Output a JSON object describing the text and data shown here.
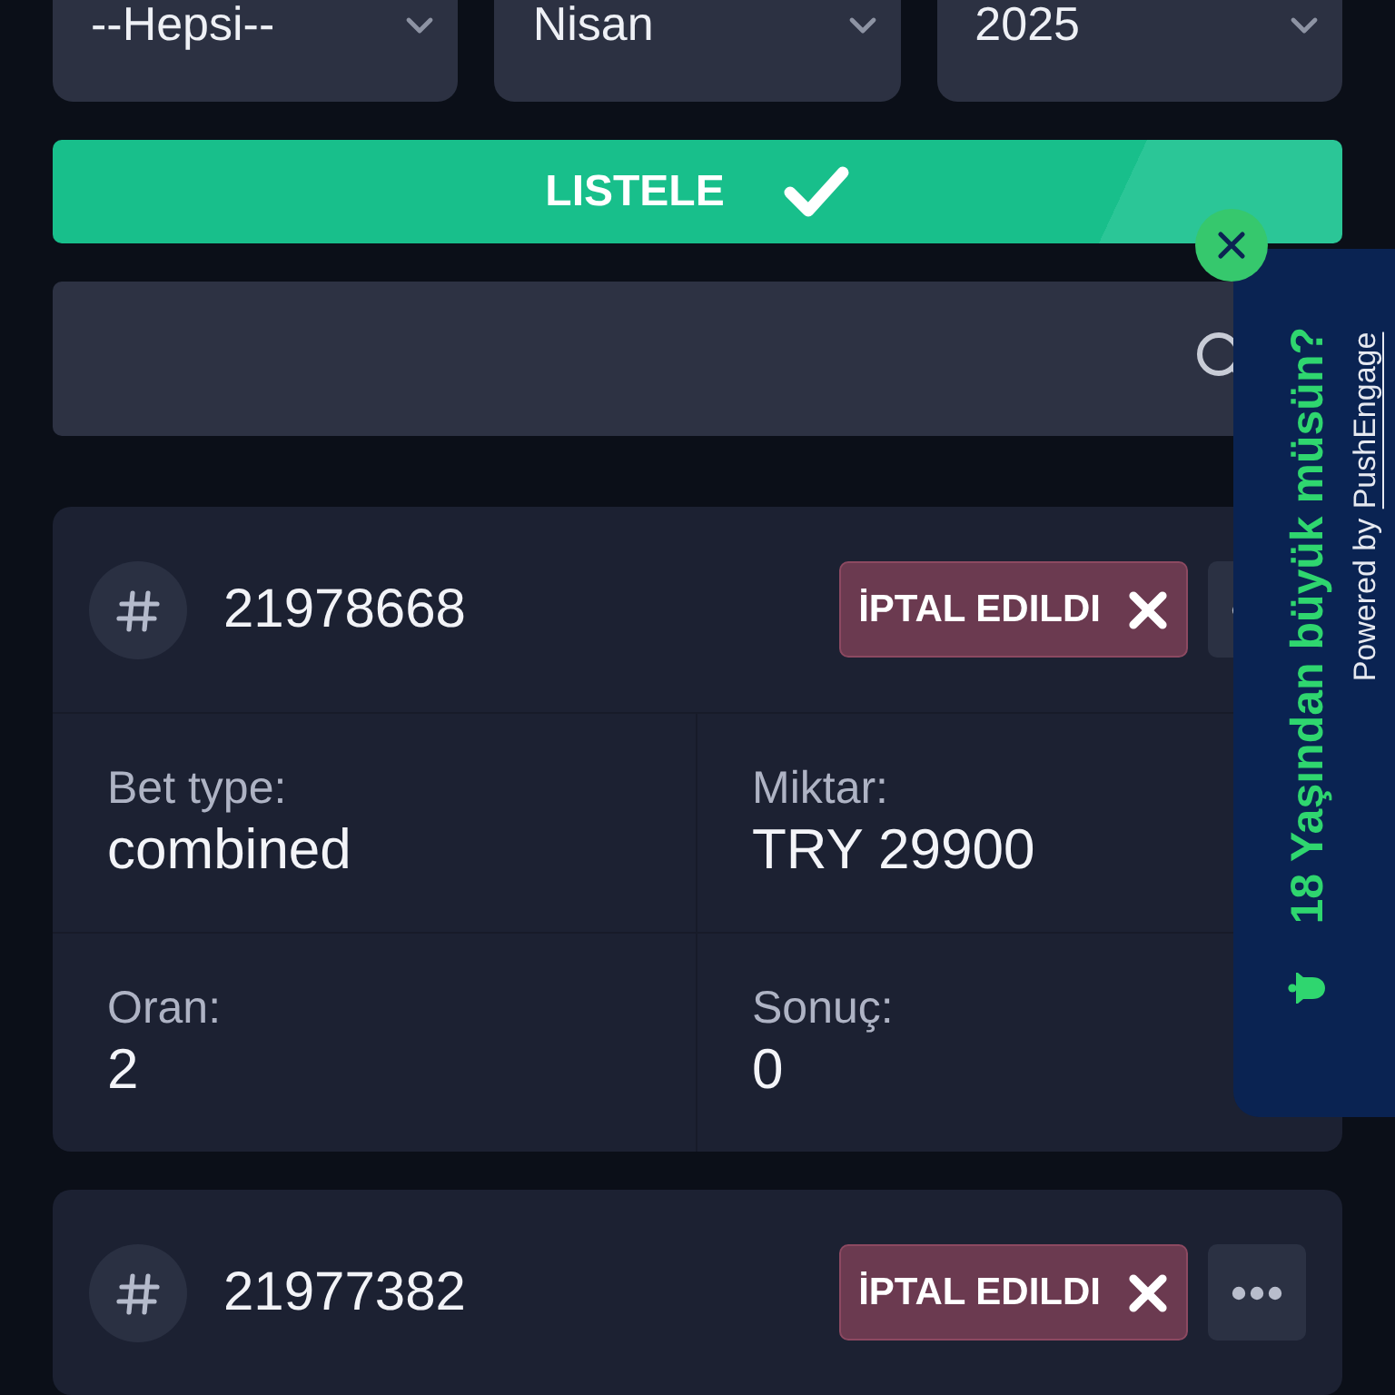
{
  "filters": [
    {
      "value": "--Hepsi--"
    },
    {
      "value": "Nisan"
    },
    {
      "value": "2025"
    }
  ],
  "list_button": {
    "label": "LISTELE"
  },
  "bets": [
    {
      "id": "21978668",
      "status": {
        "label": "İPTAL EDILDI",
        "kind": "cancelled"
      },
      "fields": [
        {
          "label": "Bet type:",
          "value": "combined"
        },
        {
          "label": "Miktar:",
          "value": "TRY 29900"
        },
        {
          "label": "Oran:",
          "value": "2"
        },
        {
          "label": "Sonuç:",
          "value": "0"
        }
      ]
    },
    {
      "id": "21977382",
      "status": {
        "label": "İPTAL EDILDI",
        "kind": "cancelled"
      }
    }
  ],
  "age_prompt": {
    "title": "18 Yaşından büyük müsün?",
    "credit": "Powered by",
    "credit_link": "PushEngage"
  }
}
